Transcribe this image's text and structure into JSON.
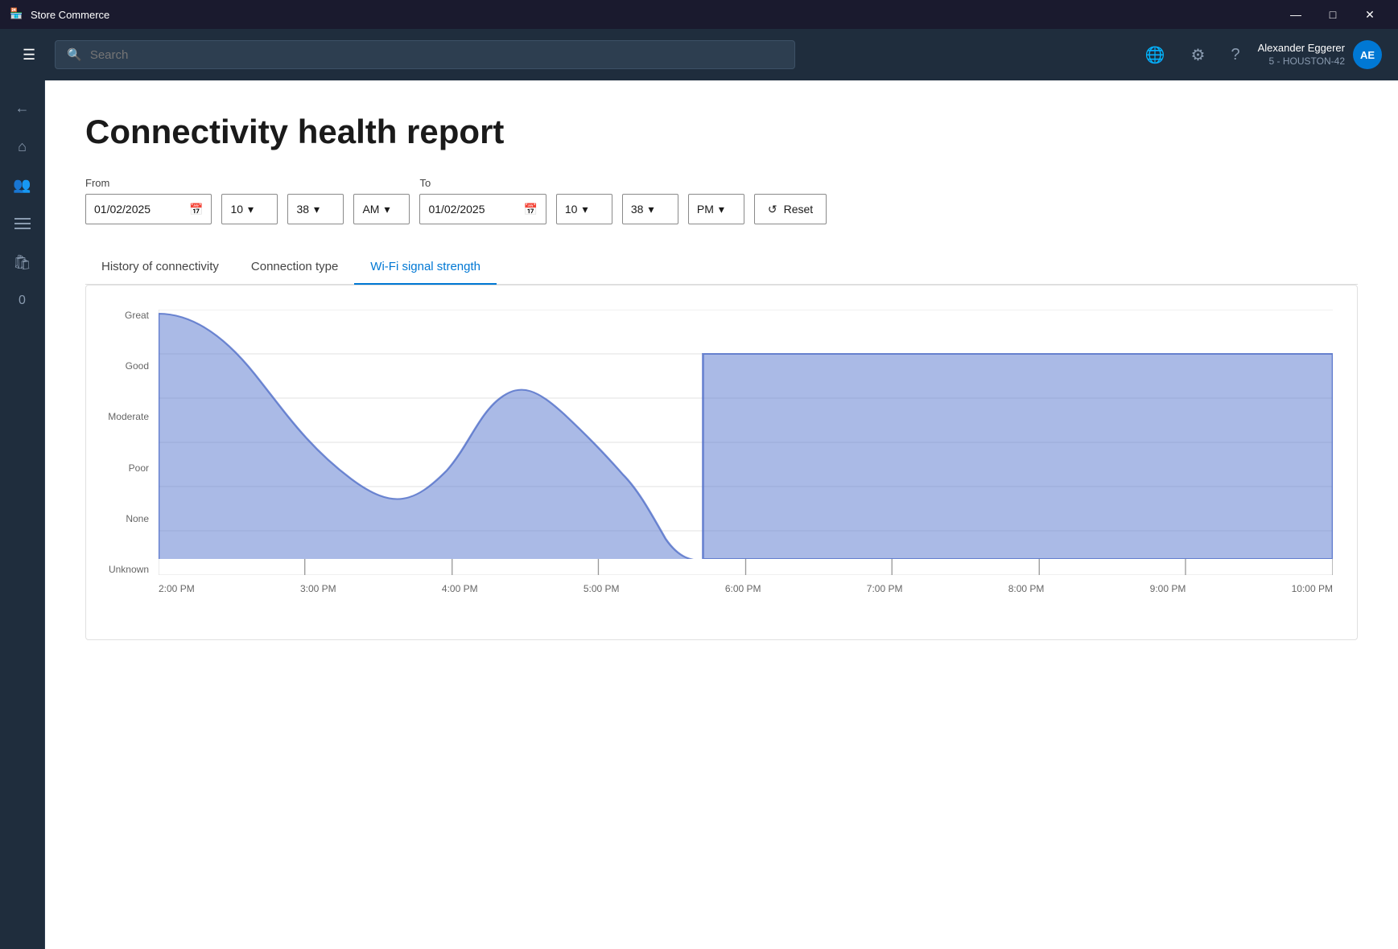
{
  "titleBar": {
    "appIcon": "🏪",
    "title": "Store Commerce",
    "minimizeLabel": "—",
    "maximizeLabel": "□",
    "closeLabel": "✕"
  },
  "topNav": {
    "hamburgerIcon": "☰",
    "searchPlaceholder": "Search",
    "globeIcon": "🌐",
    "settingsIcon": "⚙",
    "helpIcon": "?",
    "user": {
      "name": "Alexander Eggerer",
      "subtitle": "5 - HOUSTON-42",
      "avatarText": "AE"
    }
  },
  "sidebar": {
    "items": [
      {
        "icon": "←",
        "name": "back"
      },
      {
        "icon": "⌂",
        "name": "home"
      },
      {
        "icon": "👥",
        "name": "customers"
      },
      {
        "icon": "☰",
        "name": "menu"
      },
      {
        "icon": "🛍",
        "name": "orders"
      },
      {
        "icon": "0",
        "name": "zero"
      }
    ]
  },
  "page": {
    "title": "Connectivity health report",
    "fromLabel": "From",
    "toLabel": "To",
    "fromDate": "01/02/2025",
    "toDate": "01/02/2025",
    "fromHour": "10",
    "fromMinute": "38",
    "fromAmPm": "AM",
    "toHour": "10",
    "toMinute": "38",
    "toAmPm": "PM",
    "resetLabel": "Reset",
    "tabs": [
      {
        "id": "history",
        "label": "History of connectivity"
      },
      {
        "id": "connection",
        "label": "Connection type"
      },
      {
        "id": "wifi",
        "label": "Wi-Fi signal strength"
      }
    ],
    "activeTab": "wifi",
    "chart": {
      "yLabels": [
        "Great",
        "Good",
        "Moderate",
        "Poor",
        "None",
        "Unknown"
      ],
      "xLabels": [
        "2:00 PM",
        "3:00 PM",
        "4:00 PM",
        "5:00 PM",
        "6:00 PM",
        "7:00 PM",
        "8:00 PM",
        "9:00 PM",
        "10:00 PM"
      ],
      "fillColor": "#8fa8d8",
      "fillColorAlpha": "0.65"
    }
  }
}
